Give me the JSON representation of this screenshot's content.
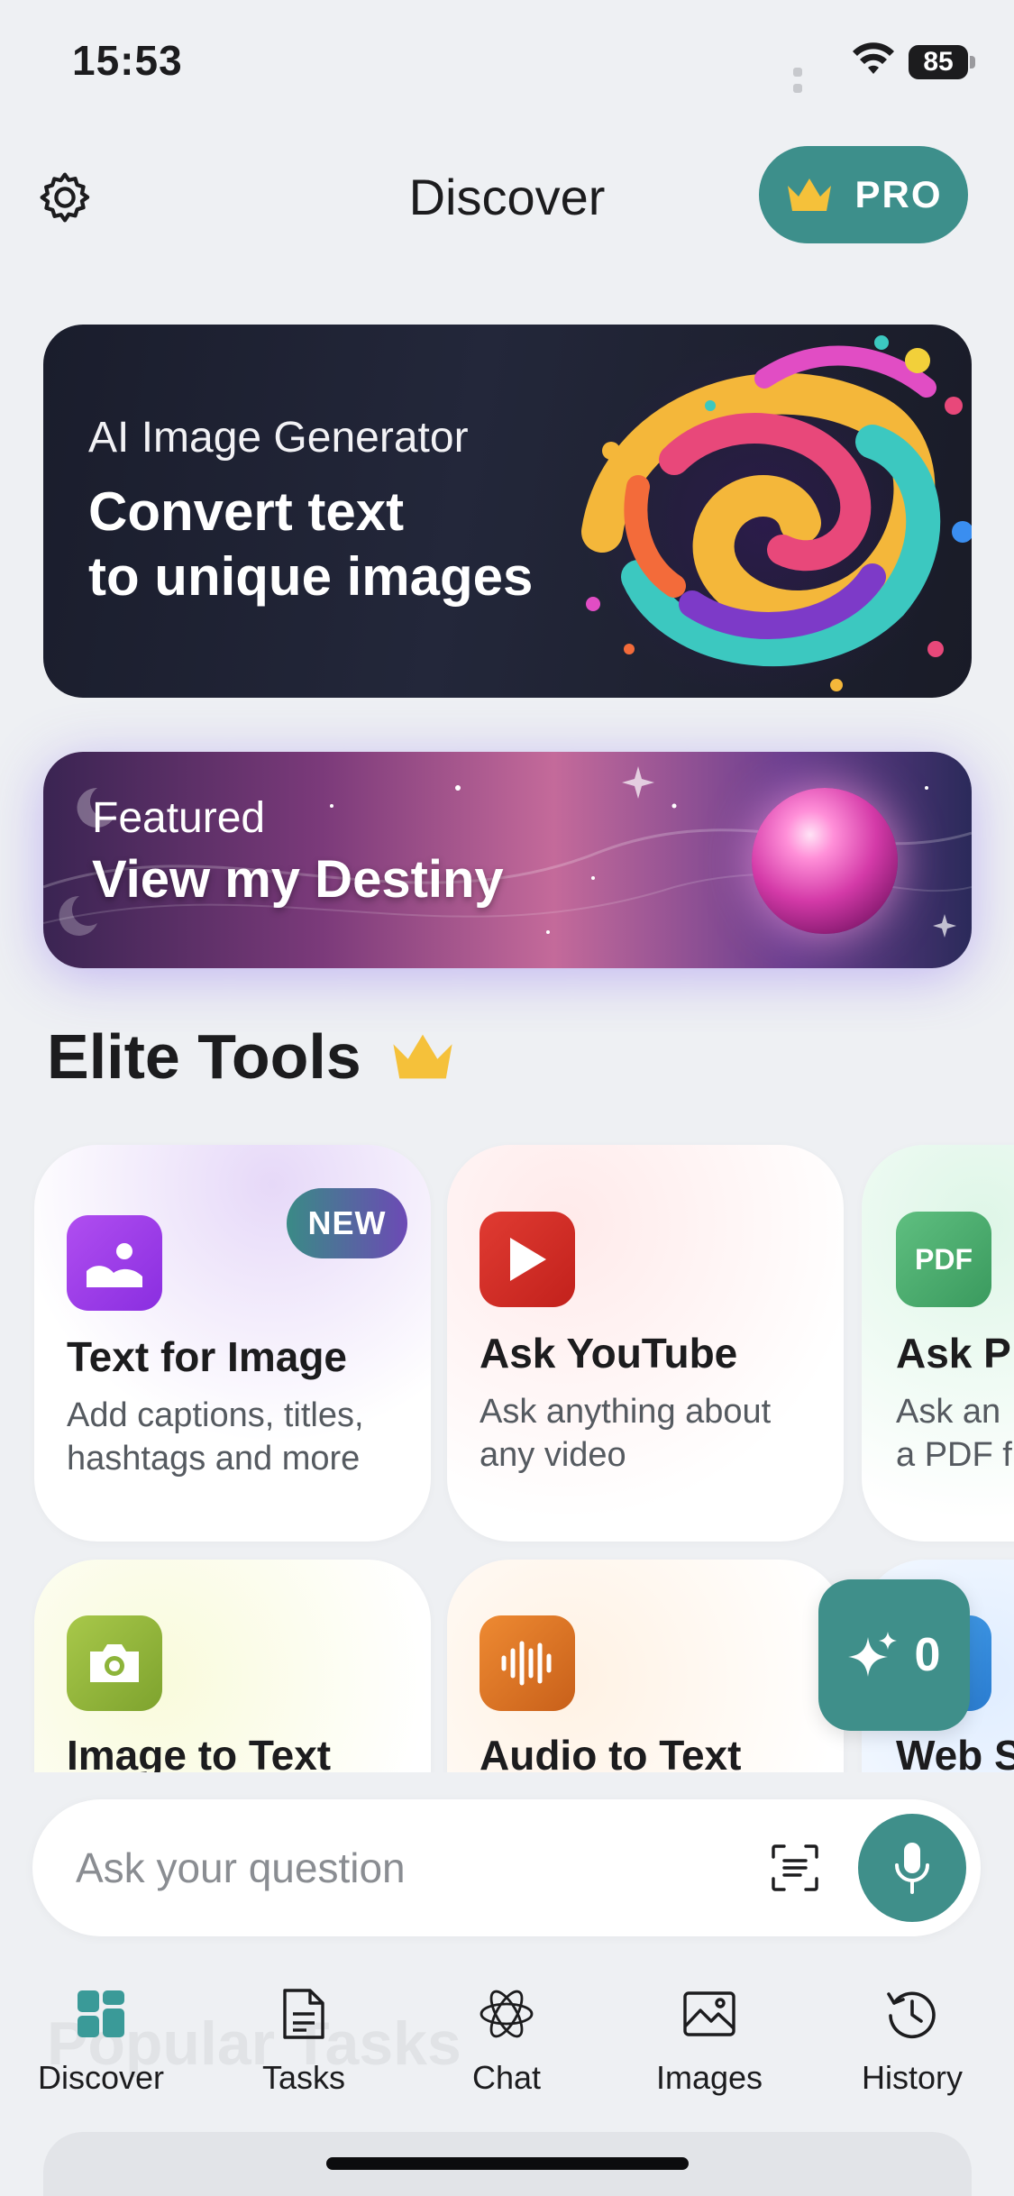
{
  "status_bar": {
    "time": "15:53",
    "battery": "85"
  },
  "header": {
    "title": "Discover",
    "pro_label": "PRO"
  },
  "hero_banner": {
    "label": "AI Image Generator",
    "headline_line1": "Convert text",
    "headline_line2": "to unique images"
  },
  "featured_banner": {
    "label": "Featured",
    "title": "View my Destiny"
  },
  "elite_tools": {
    "title": "Elite Tools",
    "cards": [
      {
        "title": "Text for Image",
        "desc": "Add captions, titles, hashtags and more",
        "badge": "NEW",
        "icon": "image-icon"
      },
      {
        "title": "Ask YouTube",
        "desc": "Ask anything about any video",
        "icon": "youtube-play-icon"
      },
      {
        "title": "Ask P",
        "desc_line1": "Ask an",
        "desc_line2": "a PDF f",
        "icon_text": "PDF",
        "icon": "pdf-icon"
      },
      {
        "title": "Image to Text",
        "icon": "camera-icon"
      },
      {
        "title": "Audio to Text",
        "icon": "waveform-icon"
      },
      {
        "title": "Web S",
        "icon": "web-icon"
      }
    ]
  },
  "credits": {
    "count": "0"
  },
  "ask_bar": {
    "placeholder": "Ask your question"
  },
  "background": {
    "popular_tasks": "Popular Tasks"
  },
  "tab_bar": {
    "tabs": [
      {
        "label": "Discover",
        "icon": "grid-icon",
        "active": true
      },
      {
        "label": "Tasks",
        "icon": "document-icon"
      },
      {
        "label": "Chat",
        "icon": "chat-swirl-icon"
      },
      {
        "label": "Images",
        "icon": "photo-icon"
      },
      {
        "label": "History",
        "icon": "history-icon"
      }
    ]
  },
  "colors": {
    "accent": "#3f8f8a",
    "background": "#eef0f3",
    "crown": "#f5c13a"
  }
}
